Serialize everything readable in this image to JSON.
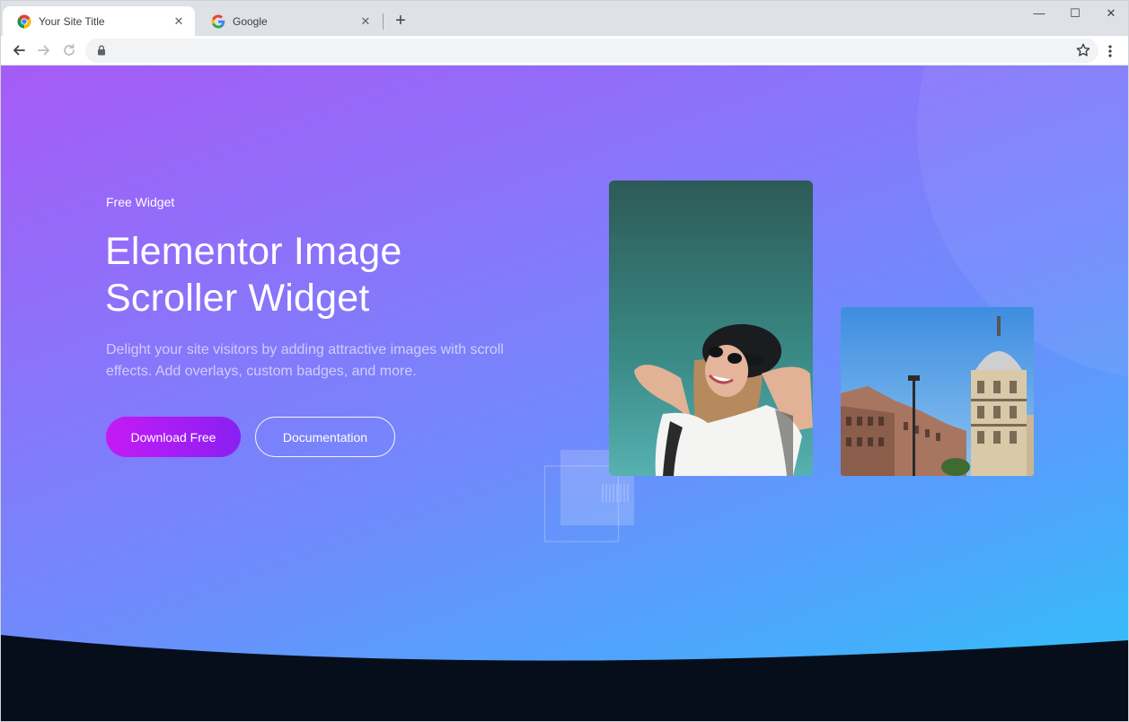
{
  "browser": {
    "tabs": [
      {
        "title": "Your Site Title",
        "active": true
      },
      {
        "title": "Google",
        "active": false
      }
    ],
    "tab_close_glyph": "✕",
    "new_tab_glyph": "+",
    "address": "",
    "window_controls": {
      "minimize": "—",
      "maximize": "☐",
      "close": "✕"
    }
  },
  "hero": {
    "eyebrow": "Free Widget",
    "title_line1": "Elementor Image",
    "title_line2": "Scroller Widget",
    "description": "Delight your site visitors by adding attractive images with scroll effects. Add overlays, custom badges, and more.",
    "primary_button": "Download Free",
    "secondary_button": "Documentation"
  },
  "colors": {
    "gradient_start": "#a65bf6",
    "gradient_end": "#2bc6fa",
    "primary_button_start": "#c51af5",
    "primary_button_end": "#8a20f2",
    "footer_dark": "#070e1b"
  },
  "icons": {
    "back": "arrow-left-icon",
    "forward": "arrow-right-icon",
    "reload": "reload-icon",
    "lock": "lock-icon",
    "bookmark": "star-icon",
    "menu": "kebab-menu-icon"
  }
}
